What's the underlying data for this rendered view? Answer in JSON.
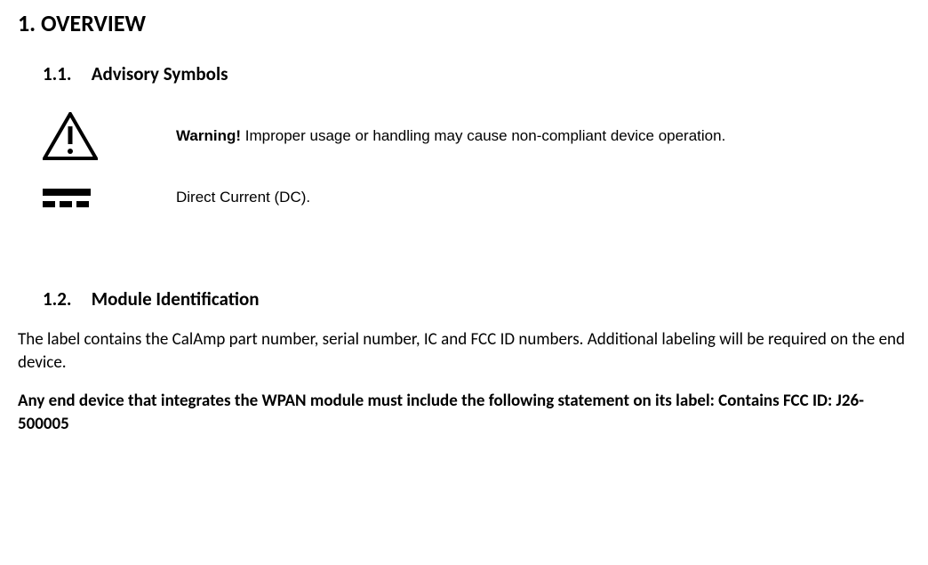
{
  "overview": {
    "number": "1.",
    "title": "OVERVIEW",
    "sub1": {
      "number": "1.1.",
      "title": "Advisory Symbols",
      "warning": {
        "label": "Warning!",
        "text": "Improper usage or handling may cause non-compliant device operation."
      },
      "dc": {
        "text": "Direct Current (DC)."
      }
    },
    "sub2": {
      "number": "1.2.",
      "title": "Module Identification",
      "para1": "The label contains the CalAmp part number, serial number, IC and FCC ID numbers.  Additional labeling will be required on the end device.",
      "para2": "Any end device that integrates the WPAN module must include the following statement on its label: Contains FCC ID:  J26-500005"
    }
  }
}
